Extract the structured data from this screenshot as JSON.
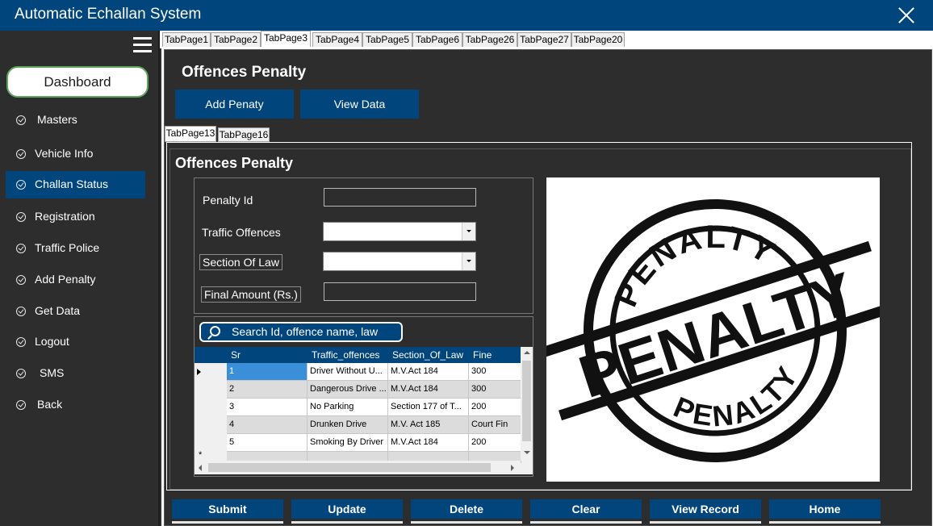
{
  "window": {
    "title": "Automatic Echallan System"
  },
  "sidebar": {
    "dashboard_label": "Dashboard",
    "items": [
      {
        "label": "Masters"
      },
      {
        "label": "Vehicle Info"
      },
      {
        "label": "Challan Status"
      },
      {
        "label": "Registration"
      },
      {
        "label": "Traffic Police"
      },
      {
        "label": "Add Penalty"
      },
      {
        "label": "Get Data"
      },
      {
        "label": "Logout"
      },
      {
        "label": "SMS"
      },
      {
        "label": "Back"
      }
    ]
  },
  "outer_tabs": [
    "TabPage1",
    "TabPage2",
    "TabPage3",
    "TabPage4",
    "TabPage5",
    "TabPage6",
    "TabPage26",
    "TabPage27",
    "TabPage20"
  ],
  "page": {
    "title": "Offences Penalty",
    "add_button": "Add Penaty",
    "view_button": "View Data"
  },
  "inner_tabs": [
    "TabPage13",
    "TabPage16"
  ],
  "form": {
    "title": "Offences Penalty",
    "penalty_id_label": "Penalty Id",
    "penalty_id_value": "",
    "traffic_offences_label": "Traffic Offences",
    "traffic_offences_value": "",
    "section_label": "Section Of Law",
    "section_value": "",
    "amount_label": "Final Amount (Rs.)",
    "amount_value": ""
  },
  "search": {
    "placeholder": "Search Id, offence name, law"
  },
  "grid": {
    "columns": [
      "Sr",
      "Traffic_offences",
      "Section_Of_Law",
      "Fine"
    ],
    "rows": [
      [
        "1",
        "Driver Without U...",
        "M.V.Act 184",
        "300"
      ],
      [
        "2",
        "Dangerous Drive ...",
        "M.V.Act 184",
        "300"
      ],
      [
        "3",
        "No Parking",
        "Section 177 of T...",
        "200"
      ],
      [
        "4",
        "Drunken Drive",
        "M.V. Act 185",
        "Court Fin"
      ],
      [
        "5",
        "Smoking By Driver",
        "M.V.Act 184",
        "200"
      ]
    ],
    "new_row_marker": "*"
  },
  "stamp": {
    "top_text": "PENALTY",
    "center_text": "PENALTY",
    "bottom_text": "PENALTY"
  },
  "actions": [
    "Submit",
    "Update",
    "Delete",
    "Clear",
    "View Record",
    "Home"
  ]
}
